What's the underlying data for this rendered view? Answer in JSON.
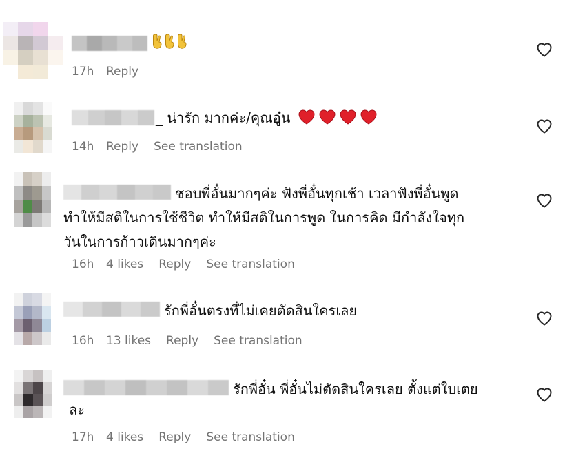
{
  "comments": [
    {
      "text_suffix": "",
      "has_hands": true,
      "time": "17h",
      "likes": "",
      "reply": "Reply",
      "translation": ""
    },
    {
      "text_suffix": "_ น่ารัก มากค่ะ/คุณอู๋น",
      "hearts": 4,
      "time": "14h",
      "likes": "",
      "reply": "Reply",
      "translation": "See translation"
    },
    {
      "text_lines": [
        "ชอบพี่อั๋นมากๆค่ะ ฟังพี่อั๋นทุกเช้า เวลาฟังพี่อั๋นพูด",
        "ทำให้มีสติในการใช้ชีวิต ทำให้มีสติในการพูด ในการคิด มีกำลังใจทุก",
        "วันในการก้าวเดินมากๆค่ะ"
      ],
      "time": "16h",
      "likes": "4 likes",
      "reply": "Reply",
      "translation": "See translation"
    },
    {
      "text_lines": [
        "รักพี่อั๋นตรงที่ไม่เคยตัดสินใครเลย"
      ],
      "time": "16h",
      "likes": "13 likes",
      "reply": "Reply",
      "translation": "See translation"
    },
    {
      "text_lines": [
        "รักพี่อั๋น พี่อั๋นไม่ตัดสินใครเลย ตั้งแต่ใบเตย",
        "ละ"
      ],
      "time": "17h",
      "likes": "4 likes",
      "reply": "Reply",
      "translation": "See translation"
    }
  ],
  "colors": {
    "meta": "#737373",
    "heart_emoji": "#e0202a",
    "hand_emoji": "#e9b733"
  },
  "icons": {
    "like": "heart-outline-icon",
    "emoji_heart": "red-heart-emoji",
    "emoji_hand": "crossed-fingers-emoji"
  }
}
